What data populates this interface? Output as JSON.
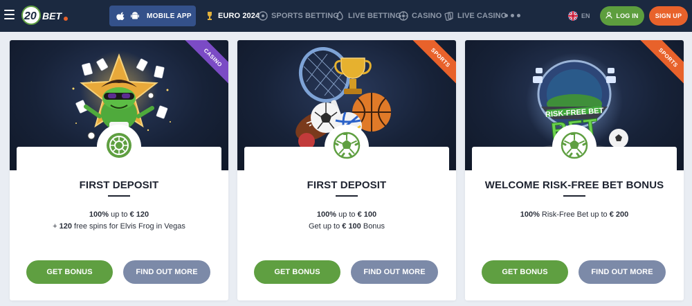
{
  "header": {
    "logo": {
      "text": "20BET"
    },
    "mobile_app": {
      "label": "MOBILE APP",
      "icons": [
        "apple-icon",
        "android-icon"
      ]
    },
    "nav": [
      {
        "label": "EURO 2024",
        "icon": "trophy-icon",
        "active": true
      },
      {
        "label": "SPORTS BETTING",
        "icon": "soccer-ball-icon",
        "active": false
      },
      {
        "label": "LIVE BETTING",
        "icon": "live-betting-icon",
        "active": false
      },
      {
        "label": "CASINO",
        "icon": "roulette-icon",
        "active": false
      },
      {
        "label": "LIVE CASINO",
        "icon": "cards-icon",
        "active": false
      }
    ],
    "more_icon": "more-dots-icon",
    "language": {
      "label": "EN",
      "icon": "uk-flag-icon"
    },
    "login": {
      "label": "LOG IN",
      "icon": "user-icon"
    },
    "signup": {
      "label": "SIGN UP"
    }
  },
  "cards": [
    {
      "ribbon": "CASINO",
      "ribbon_color": "#7b4bc5",
      "badge_icon": "roulette-icon",
      "title": "FIRST DEPOSIT",
      "lines": [
        {
          "bold_a": "100%",
          "text_a": " up to ",
          "bold_b": "€ 120",
          "text_b": ""
        },
        {
          "bold_a": "",
          "text_a": "+ ",
          "bold_b": "120",
          "text_b": " free spins for Elvis Frog in Vegas"
        }
      ],
      "primary_button": "GET BONUS",
      "secondary_button": "FIND OUT MORE"
    },
    {
      "ribbon": "SPORTS",
      "ribbon_color": "#e8622b",
      "badge_icon": "soccer-ball-icon",
      "title": "FIRST DEPOSIT",
      "lines": [
        {
          "bold_a": "100%",
          "text_a": " up to ",
          "bold_b": "€ 100",
          "text_b": ""
        },
        {
          "bold_a": "",
          "text_a": "Get up to ",
          "bold_b": "€ 100",
          "text_b": " Bonus"
        }
      ],
      "primary_button": "GET BONUS",
      "secondary_button": "FIND OUT MORE"
    },
    {
      "ribbon": "SPORTS",
      "ribbon_color": "#e8622b",
      "badge_icon": "soccer-ball-icon",
      "title": "WELCOME RISK-FREE BET BONUS",
      "hero_text": "RISK-FREE BET",
      "lines": [
        {
          "bold_a": "100%",
          "text_a": " Risk-Free Bet up to ",
          "bold_b": "€ 200",
          "text_b": ""
        }
      ],
      "primary_button": "GET BONUS",
      "secondary_button": "FIND OUT MORE"
    }
  ],
  "colors": {
    "header_bg": "#1b2940",
    "accent_green": "#5f9f41",
    "accent_orange": "#e8622b",
    "secondary_btn": "#7c8aa8",
    "page_bg": "#e9edf3"
  }
}
